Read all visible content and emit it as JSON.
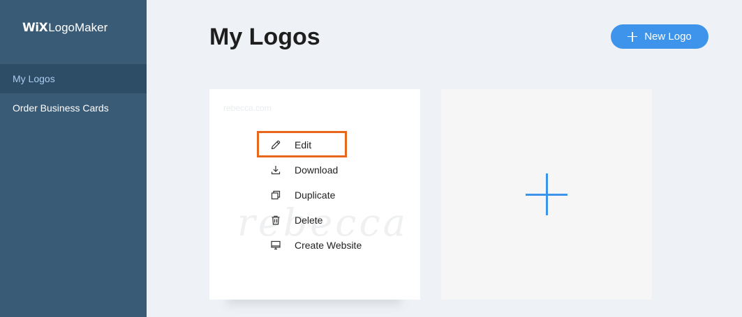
{
  "sidebar": {
    "brand_wix": "WiX",
    "brand_rest": "LogoMaker",
    "items": [
      {
        "label": "My Logos",
        "active": true
      },
      {
        "label": "Order Business Cards",
        "active": false
      }
    ]
  },
  "main": {
    "title": "My Logos",
    "new_logo_label": "New Logo"
  },
  "logo_card": {
    "faded_name": "rebecca.com",
    "watermark": "rebecca",
    "menu": [
      {
        "label": "Edit",
        "icon": "pencil-icon",
        "highlighted": true
      },
      {
        "label": "Download",
        "icon": "download-icon"
      },
      {
        "label": "Duplicate",
        "icon": "duplicate-icon"
      },
      {
        "label": "Delete",
        "icon": "trash-icon"
      },
      {
        "label": "Create Website",
        "icon": "monitor-icon"
      }
    ]
  },
  "colors": {
    "sidebar_bg": "#3a5b76",
    "sidebar_active_bg": "#2d4d67",
    "accent": "#3d94ea",
    "highlight": "#e8671b",
    "page_bg": "#eef2f6"
  }
}
